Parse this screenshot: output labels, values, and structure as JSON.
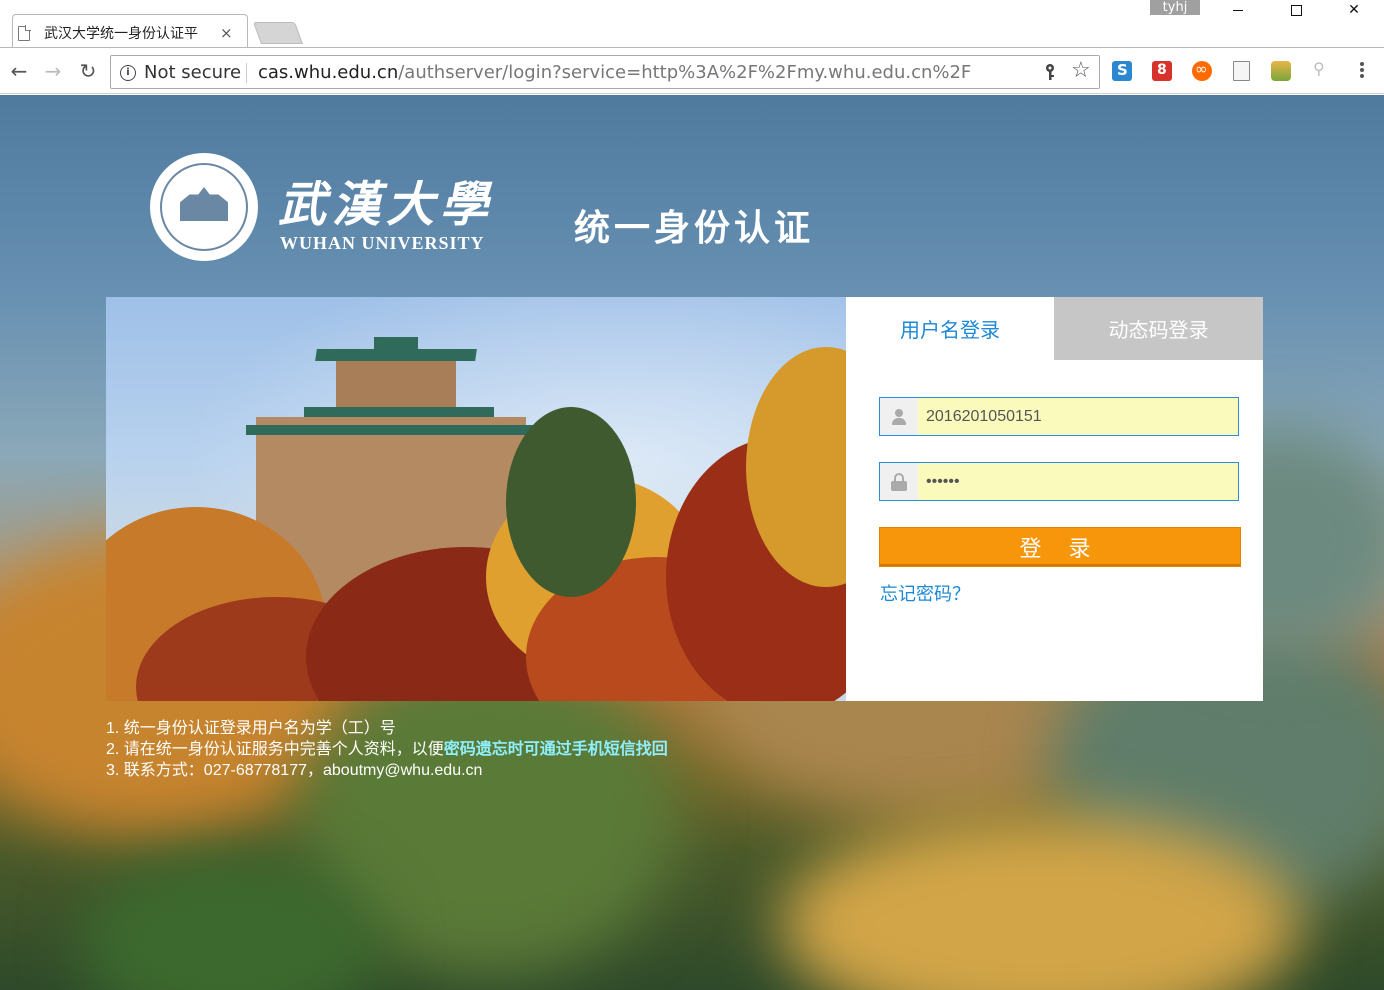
{
  "browser": {
    "tab_title": "武汉大学统一身份认证平",
    "tab_close": "×",
    "profile_name": "tyhj",
    "security_label": "Not secure",
    "url_host": "cas.whu.edu.cn",
    "url_path": "/authserver/login?service=http%3A%2F%2Fmy.whu.edu.cn%2F"
  },
  "header": {
    "university_cn": "武漢大學",
    "university_en": "WUHAN UNIVERSITY",
    "portal_title": "统一身份认证"
  },
  "login": {
    "tabs": [
      {
        "label": "用户名登录",
        "active": true
      },
      {
        "label": "动态码登录",
        "active": false
      }
    ],
    "username_value": "2016201050151",
    "password_value": "••••••",
    "submit_label": "登 录",
    "forgot_label": "忘记密码？"
  },
  "notes": {
    "line1": "1. 统一身份认证登录用户名为学（工）号",
    "line2_prefix": "2. 请在统一身份认证服务中完善个人资料，以便",
    "line2_highlight": "密码遗忘时可通过手机短信找回",
    "line3": "3. 联系方式：027-68778177，aboutmy@whu.edu.cn"
  },
  "colors": {
    "accent_blue": "#1d88d6",
    "login_orange": "#f7960a",
    "input_fill": "#fafabc",
    "note_highlight": "#8ff0ff"
  },
  "icons": [
    "page-icon",
    "back-arrow-icon",
    "forward-arrow-icon",
    "reload-icon",
    "info-icon",
    "key-icon",
    "star-icon",
    "user-icon",
    "lock-icon",
    "menu-dots-icon"
  ]
}
